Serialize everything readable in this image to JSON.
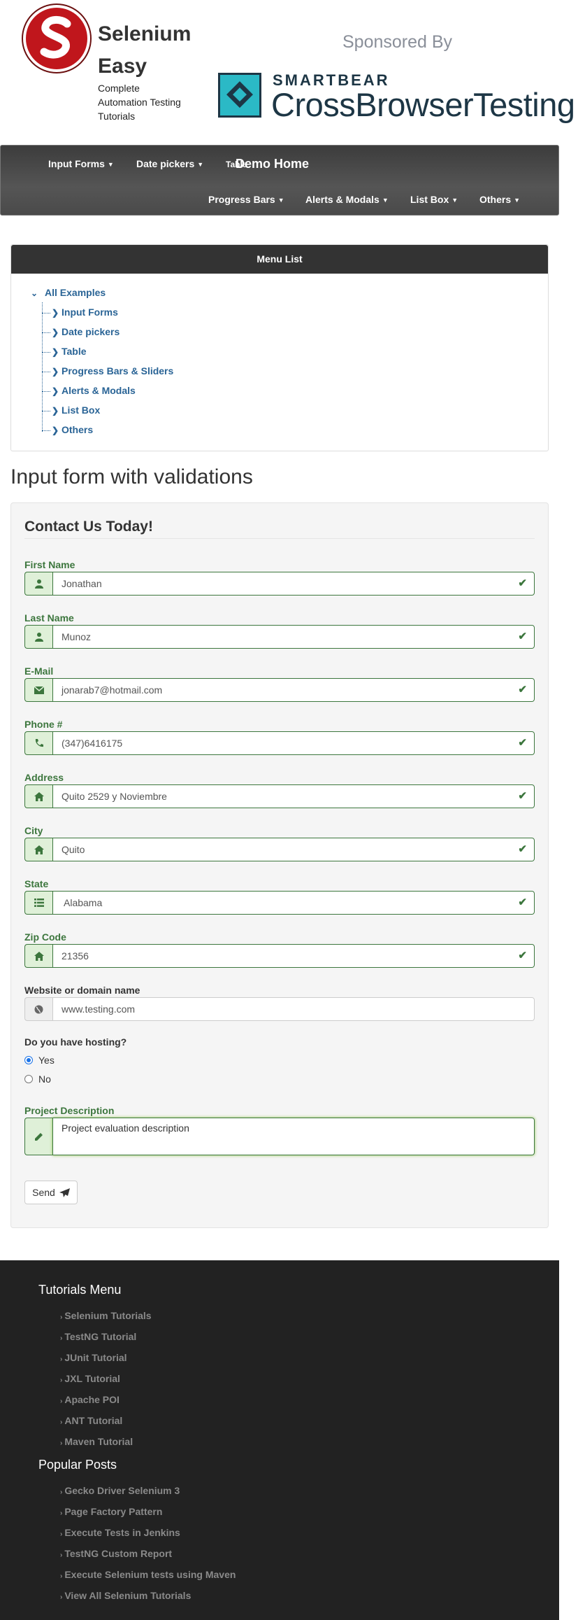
{
  "brand": {
    "name_line1": "Selenium",
    "name_line2": "Easy",
    "tagline_line1": "Complete",
    "tagline_line2": "Automation Testing",
    "tagline_line3": "Tutorials"
  },
  "sponsor": {
    "label": "Sponsored By",
    "company_small": "SMARTBEAR",
    "company_big": "CrossBrowserTesting"
  },
  "nav": {
    "demo_home": "Demo Home",
    "row1": [
      "Input Forms",
      "Date pickers"
    ],
    "table_overlap": "Table",
    "row2": [
      "Progress Bars",
      "Alerts & Modals",
      "List Box",
      "Others"
    ]
  },
  "menu": {
    "header": "Menu List",
    "root": "All Examples",
    "items": [
      "Input Forms",
      "Date pickers",
      "Table",
      "Progress Bars & Sliders",
      "Alerts & Modals",
      "List Box",
      "Others"
    ]
  },
  "page": {
    "title": "Input form with validations"
  },
  "form": {
    "legend": "Contact Us Today!",
    "fields": [
      {
        "label": "First Name",
        "value": "Jonathan"
      },
      {
        "label": "Last Name",
        "value": "Munoz"
      },
      {
        "label": "E-Mail",
        "value": "jonarab7@hotmail.com"
      },
      {
        "label": "Phone #",
        "value": "(347)6416175"
      },
      {
        "label": "Address",
        "value": "Quito 2529 y Noviembre"
      },
      {
        "label": "City",
        "value": "Quito"
      },
      {
        "label": "State",
        "value": "Alabama"
      },
      {
        "label": "Zip Code",
        "value": "21356"
      },
      {
        "label": "Website or domain name",
        "value": "www.testing.com"
      }
    ],
    "hosting_question": "Do you have hosting?",
    "hosting_options": [
      "Yes",
      "No"
    ],
    "hosting_selected": "Yes",
    "description_label": "Project Description",
    "description_value": "Project evaluation description",
    "send_label": "Send"
  },
  "footer": {
    "tutorials_heading": "Tutorials Menu",
    "tutorials": [
      "Selenium Tutorials",
      "TestNG Tutorial",
      "JUnit Tutorial",
      "JXL Tutorial",
      "Apache POI",
      "ANT Tutorial",
      "Maven Tutorial"
    ],
    "posts_heading": "Popular Posts",
    "posts": [
      "Gecko Driver Selenium 3",
      "Page Factory Pattern",
      "Execute Tests in Jenkins",
      "TestNG Custom Report",
      "Execute Selenium tests using Maven",
      "View All Selenium Tutorials"
    ]
  },
  "colors": {
    "success": "#3c763d",
    "link": "#2a6496",
    "footer_bg": "#222222",
    "brand_red": "#c0161c",
    "cbt_teal": "#2bb9c6"
  }
}
